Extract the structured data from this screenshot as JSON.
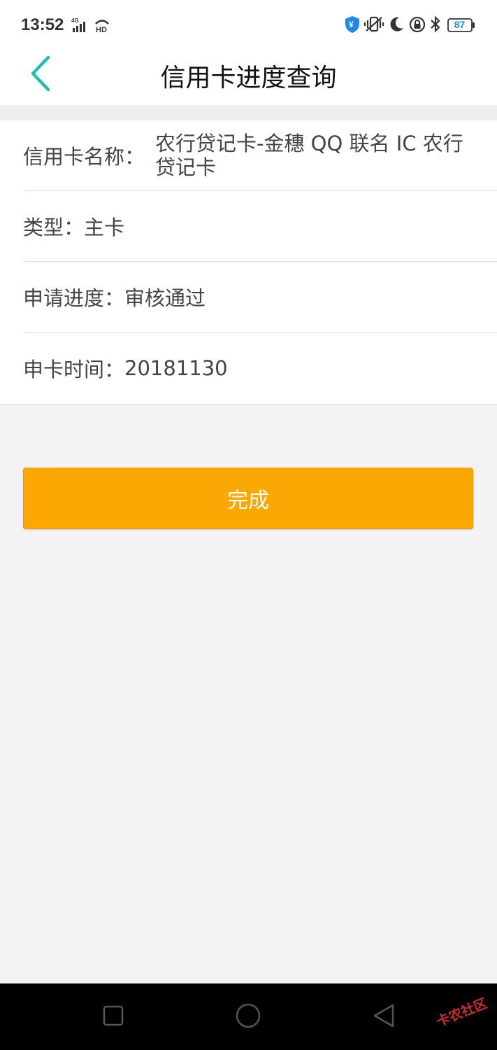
{
  "status_bar": {
    "time": "13:52",
    "battery": "87",
    "icons": [
      "signal-4g-icon",
      "hd-icon",
      "shield-icon",
      "vibrate-icon",
      "moon-icon",
      "lock-rotation-icon",
      "bluetooth-icon",
      "battery-icon"
    ]
  },
  "header": {
    "title": "信用卡进度查询",
    "back_icon": "chevron-left-icon"
  },
  "details": {
    "card_name_label": "信用卡名称：",
    "card_name_value": "农行贷记卡-金穗 QQ 联名 IC 农行贷记卡",
    "type_label": "类型：",
    "type_value": "主卡",
    "progress_label": "申请进度：",
    "progress_value": "审核通过",
    "time_label": "申卡时间：",
    "time_value": "20181130"
  },
  "actions": {
    "done_label": "完成"
  },
  "system_nav": {
    "icons": [
      "recent-apps-icon",
      "home-icon",
      "back-icon"
    ]
  },
  "watermark": {
    "text": "卡农社区"
  },
  "colors": {
    "accent": "#1dbfae",
    "button": "#fba704",
    "background": "#f5f2f6"
  }
}
